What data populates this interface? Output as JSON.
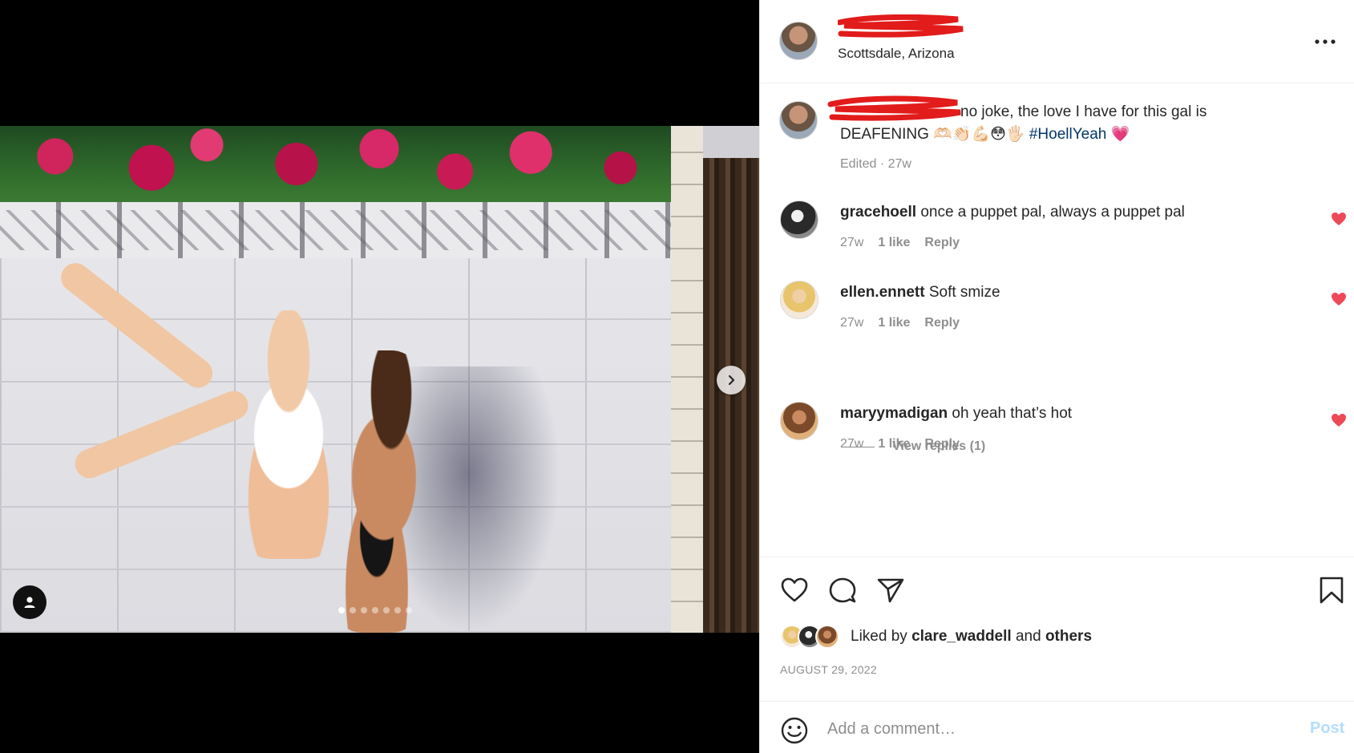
{
  "post": {
    "location": "Scottsdale, Arizona",
    "caption": "no joke, the love I have for this gal is DEAFENING",
    "caption_emojis": "🫶🏻👏🏻💪🏻😳🖐🏻",
    "hashtag": "#HoellYeah",
    "caption_end_emoji": "💗",
    "caption_meta": "Edited · 27w",
    "carousel": {
      "total": 7,
      "active_index": 0
    }
  },
  "comments": [
    {
      "user": "gracehoell",
      "text": "once a puppet pal, always a puppet pal",
      "age": "27w",
      "likes": "1 like",
      "reply": "Reply"
    },
    {
      "user": "ellen.ennett",
      "text": "Soft smize",
      "age": "27w",
      "likes": "1 like",
      "reply": "Reply"
    },
    {
      "user": "maryymadigan",
      "text": "oh yeah that’s hot",
      "age": "27w",
      "likes": "1 like",
      "reply": "Reply"
    }
  ],
  "view_replies": "View replies (1)",
  "likes": {
    "prefix": "Liked by",
    "user": "clare_waddell",
    "joiner": "and",
    "others": "others"
  },
  "date": "AUGUST 29, 2022",
  "composer": {
    "placeholder": "Add a comment…",
    "post_label": "Post"
  },
  "colors": {
    "heart": "#ed4956",
    "link": "#00376b",
    "post_disabled": "#b2dffc",
    "redaction": "#e21b1b"
  },
  "icons": [
    "user-tag-icon",
    "chevron-right-icon",
    "more-icon",
    "heart-icon",
    "comment-icon",
    "share-icon",
    "bookmark-icon",
    "emoji-icon"
  ]
}
